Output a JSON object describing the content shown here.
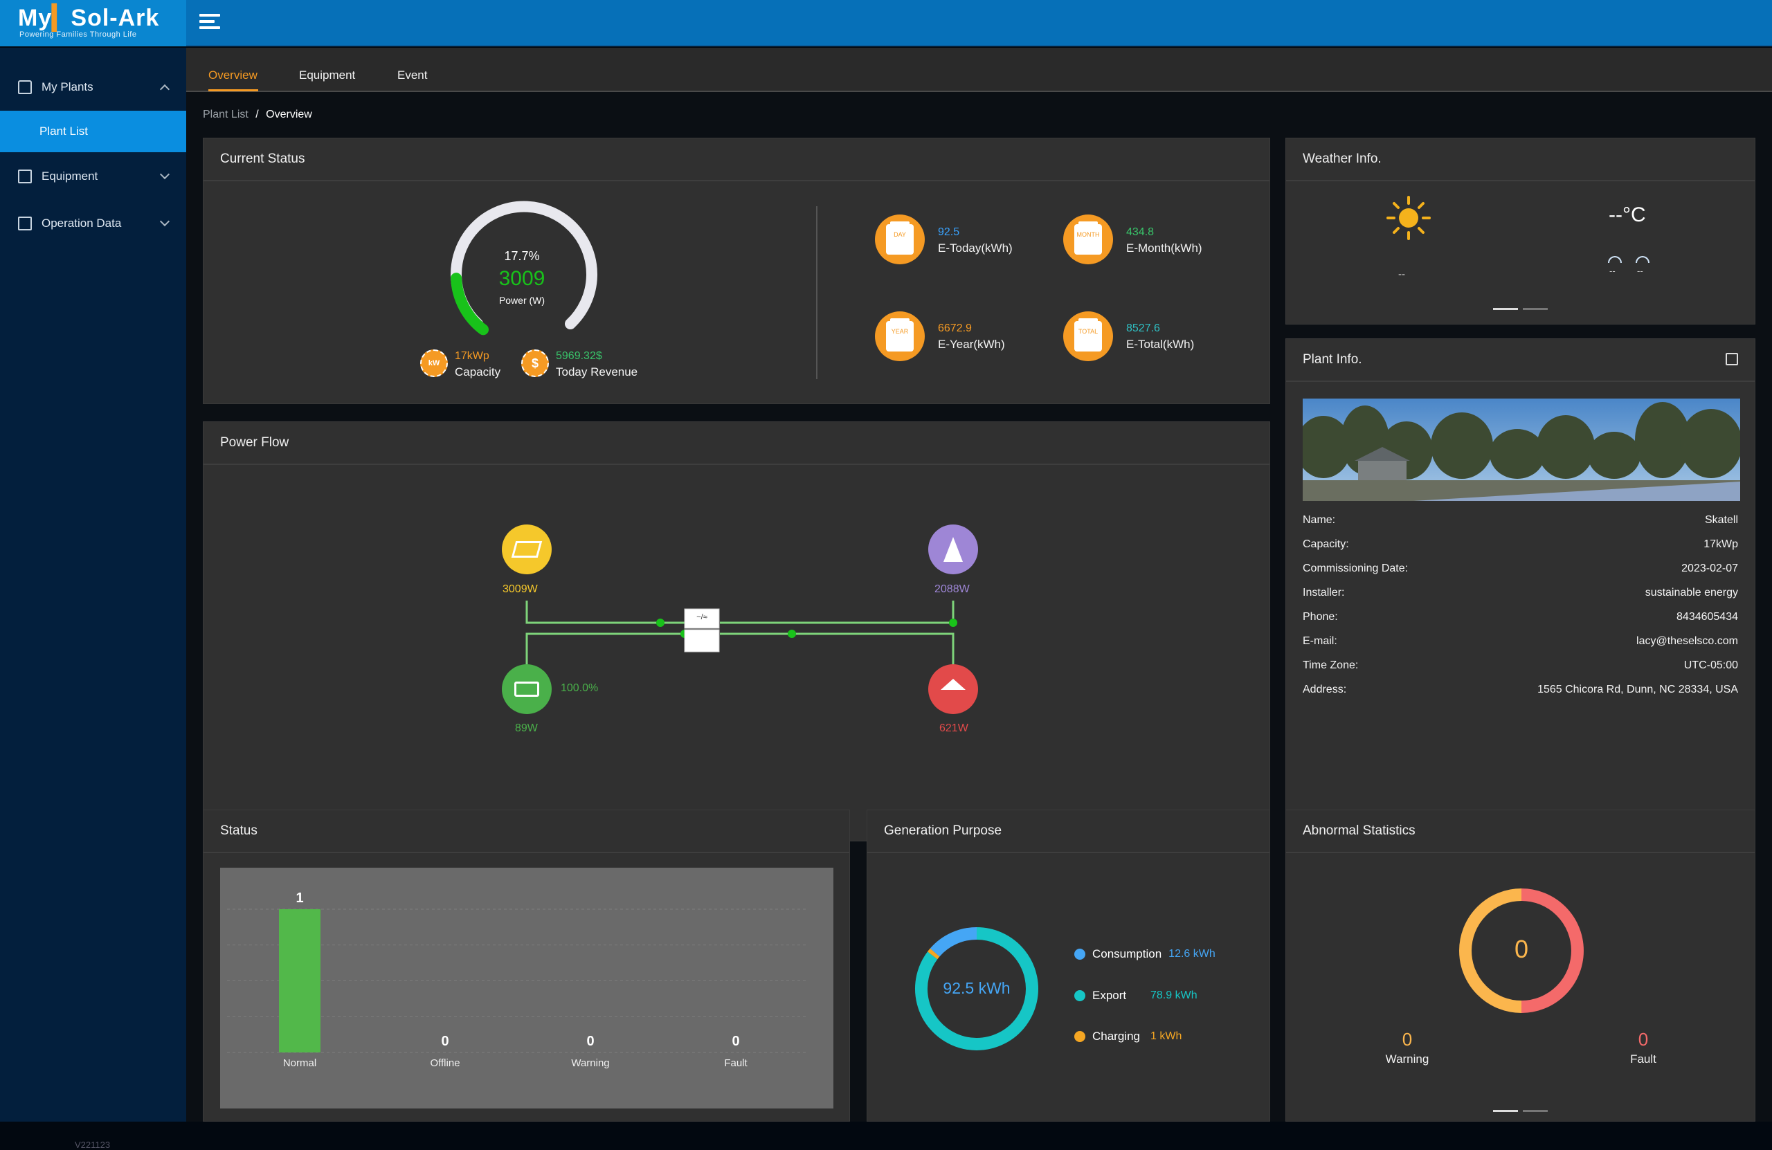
{
  "app": {
    "logo_my": "My",
    "logo_solark": "Sol-Ark",
    "tagline": "Powering Families Through Life",
    "version": "V221123"
  },
  "sidebar": {
    "items": [
      {
        "label": "My Plants"
      },
      {
        "label": "Plant List"
      },
      {
        "label": "Equipment"
      },
      {
        "label": "Operation Data"
      }
    ]
  },
  "tabs": [
    {
      "label": "Overview"
    },
    {
      "label": "Equipment"
    },
    {
      "label": "Event"
    }
  ],
  "breadcrumb": {
    "parent": "Plant List",
    "sep": "/",
    "current": "Overview"
  },
  "current_status": {
    "title": "Current Status",
    "percent": "17.7%",
    "percent_value": 17.7,
    "power": "3009",
    "power_label": "Power (W)",
    "capacity_value": "17kWp",
    "capacity_label": "Capacity",
    "revenue_value": "5969.32$",
    "revenue_label": "Today Revenue",
    "stats": [
      {
        "badge": "DAY",
        "value": "92.5",
        "label": "E-Today(kWh)",
        "color": "#3aa3ff"
      },
      {
        "badge": "MONTH",
        "value": "434.8",
        "label": "E-Month(kWh)",
        "color": "#39c46a"
      },
      {
        "badge": "YEAR",
        "value": "6672.9",
        "label": "E-Year(kWh)",
        "color": "#f59a23"
      },
      {
        "badge": "TOTAL",
        "value": "8527.6",
        "label": "E-Total(kWh)",
        "color": "#2fc0c4"
      }
    ]
  },
  "weather": {
    "title": "Weather Info.",
    "temp": "--°C",
    "condition": "--",
    "sunrise": "--",
    "sunset": "--"
  },
  "plant_info": {
    "title": "Plant Info.",
    "rows": [
      {
        "k": "Name:",
        "v": "Skatell"
      },
      {
        "k": "Capacity:",
        "v": "17kWp"
      },
      {
        "k": "Commissioning Date:",
        "v": "2023-02-07"
      },
      {
        "k": "Installer:",
        "v": "sustainable energy"
      },
      {
        "k": "Phone:",
        "v": "8434605434"
      },
      {
        "k": "E-mail:",
        "v": "lacy@theselsco.com"
      },
      {
        "k": "Time Zone:",
        "v": "UTC-05:00"
      },
      {
        "k": "Address:",
        "v": "1565 Chicora Rd, Dunn, NC 28334, USA"
      }
    ]
  },
  "power_flow": {
    "title": "Power Flow",
    "solar": "3009W",
    "grid": "2088W",
    "battery": "89W",
    "battery_soc": "100.0%",
    "load": "621W"
  },
  "status": {
    "title": "Status",
    "colors": {
      "bar": "#52b84a"
    }
  },
  "generation": {
    "title": "Generation Purpose",
    "total": "92.5 kWh",
    "items": [
      {
        "label": "Consumption",
        "value": "12.6 kWh",
        "color": "#45a6f5",
        "amount": 12.6
      },
      {
        "label": "Export",
        "value": "78.9 kWh",
        "color": "#16c6c6",
        "amount": 78.9
      },
      {
        "label": "Charging",
        "value": "1 kWh",
        "color": "#f5a623",
        "amount": 1
      }
    ]
  },
  "abnormal": {
    "title": "Abnormal Statistics",
    "total": "0",
    "warning_value": "0",
    "warning_label": "Warning",
    "fault_value": "0",
    "fault_label": "Fault",
    "colors": {
      "warning": "#fbb64d",
      "fault": "#f46a6a"
    }
  },
  "chart_data": {
    "type": "bar",
    "categories": [
      "Normal",
      "Offline",
      "Warning",
      "Fault"
    ],
    "values": [
      1,
      0,
      0,
      0
    ],
    "title": "",
    "xlabel": "",
    "ylabel": "",
    "ylim": [
      0,
      1
    ],
    "grid": true
  }
}
